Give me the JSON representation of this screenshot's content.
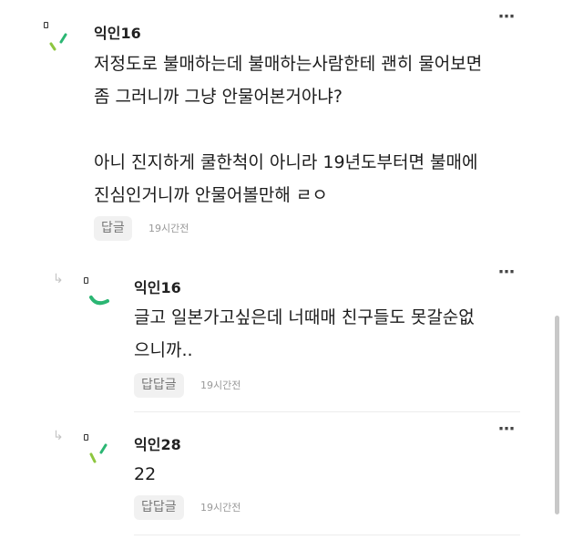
{
  "comments": [
    {
      "username": "익인16",
      "body": "저정도로 불매하는데 불매하는사람한테 괜히 물어보면\n좀 그러니까 그냥 안물어본거아냐?\n\n아니 진지하게 쿨한척이 아니라 19년도부터면 불매에\n진심인거니까 안물어볼만해 ㄹㅇ",
      "reply_label": "답글",
      "time": "19시간전",
      "more": "⋯",
      "avatar_color": "#2bb673"
    },
    {
      "username": "익인16",
      "body": "글고 일본가고싶은데 너때매 친구들도 못갈순없\n으니까..",
      "reply_label": "답답글",
      "time": "19시간전",
      "more": "⋯",
      "reply_arrow": "↳",
      "avatar_color": "#2bb673"
    },
    {
      "username": "익인28",
      "body": "22",
      "reply_label": "답답글",
      "time": "19시간전",
      "more": "⋯",
      "reply_arrow": "↳",
      "avatar_color": "#2bb673"
    }
  ]
}
